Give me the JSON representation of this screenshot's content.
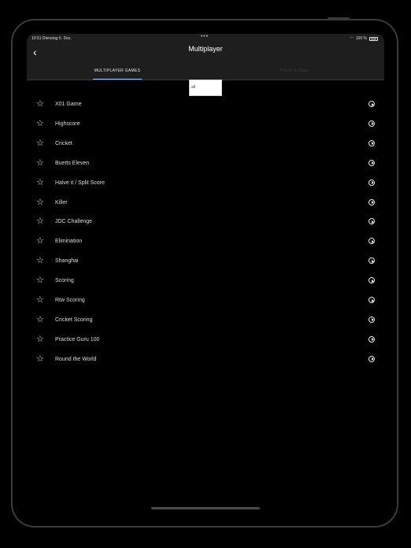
{
  "status_bar": {
    "time": "10:51  Dienstag 5. Dez.",
    "battery": "100 %"
  },
  "nav": {
    "back_icon": "chevron-left-icon",
    "title": "Multiplayer"
  },
  "tabs": [
    {
      "label": "MULTIPLAYER GAMES",
      "active": true
    },
    {
      "label": "Player & Stats",
      "active": false
    }
  ],
  "search": {
    "value": "all"
  },
  "games": [
    "X01 Game",
    "Highscore",
    "Cricket",
    "Buetts Eleven",
    "Halve it / Split Score",
    "Killer",
    "JDC Challenge",
    "Elimination",
    "Shanghai",
    "Scoring",
    "Rtw Scoring",
    "Cricket Scoring",
    "Practice Guru 100",
    "Round the World"
  ]
}
